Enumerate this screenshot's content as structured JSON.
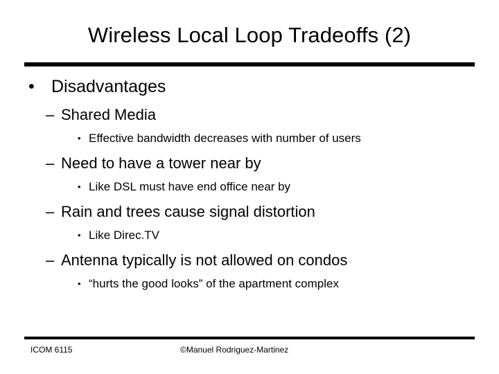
{
  "slide": {
    "title": "Wireless Local Loop Tradeoffs (2)",
    "bullet_glyph_level1": "•",
    "bullet_glyph_level2": "–",
    "bullet_glyph_level3": "•",
    "content": [
      {
        "level": 1,
        "text": "Disadvantages"
      },
      {
        "level": 2,
        "text": "Shared Media"
      },
      {
        "level": 3,
        "text": "Effective bandwidth decreases with number of users"
      },
      {
        "level": 2,
        "text": "Need to have a tower near by"
      },
      {
        "level": 3,
        "text": "Like DSL must have end office near by"
      },
      {
        "level": 2,
        "text": "Rain and trees cause signal distortion"
      },
      {
        "level": 3,
        "text": "Like Direc.TV"
      },
      {
        "level": 2,
        "text": "Antenna typically is not allowed on condos"
      },
      {
        "level": 3,
        "text": "“hurts the good looks” of the apartment complex"
      }
    ],
    "footer": {
      "left": "ICOM 6115",
      "center": "©Manuel Rodriguez-Martinez"
    },
    "colors": {
      "text": "#000000",
      "background": "#ffffff",
      "rule": "#000000"
    }
  }
}
